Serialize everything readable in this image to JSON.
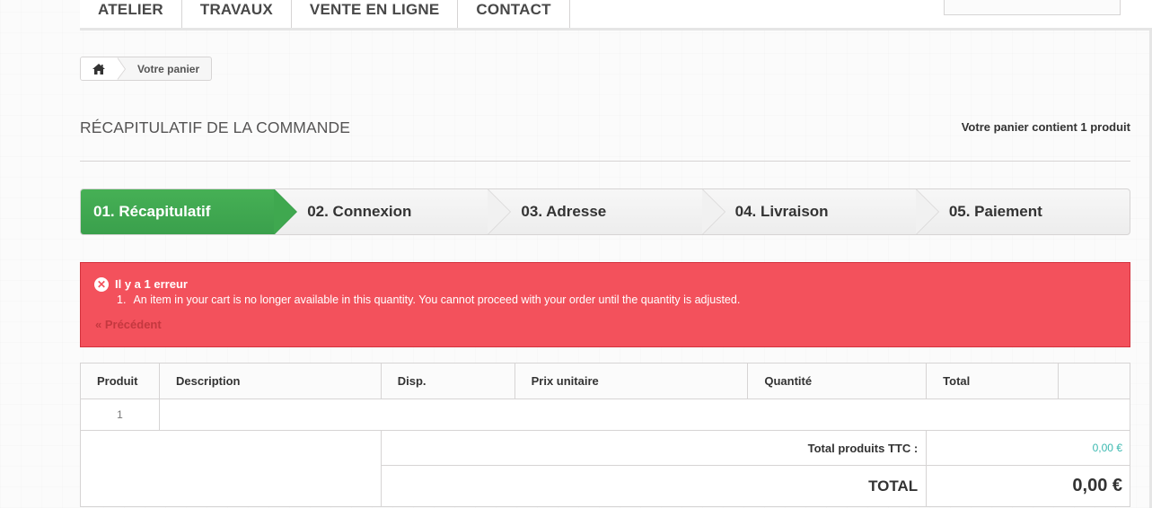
{
  "nav": {
    "items": [
      "ATELIER",
      "TRAVAUX",
      "VENTE EN LIGNE",
      "CONTACT"
    ],
    "search_placeholder": ""
  },
  "breadcrumb": {
    "home_icon": "home-icon",
    "current": "Votre panier"
  },
  "heading": {
    "title": "RÉCAPITULATIF DE LA COMMANDE",
    "cart_summary": "Votre panier contient 1 produit"
  },
  "steps": [
    {
      "label": "01. Récapitulatif",
      "active": true
    },
    {
      "label": "02. Connexion",
      "active": false
    },
    {
      "label": "03. Adresse",
      "active": false
    },
    {
      "label": "04. Livraison",
      "active": false
    },
    {
      "label": "05. Paiement",
      "active": false
    }
  ],
  "alert": {
    "icon": "error-circle-icon",
    "title": "Il y a 1 erreur",
    "errors": [
      {
        "num": "1.",
        "text": "An item in your cart is no longer available in this quantity. You cannot proceed with your order until the quantity is adjusted."
      }
    ],
    "back_link": "« Précédent",
    "colors": {
      "background": "#f3515c",
      "border": "#d4323d"
    }
  },
  "table": {
    "headers": [
      "Produit",
      "Description",
      "Disp.",
      "Prix unitaire",
      "Quantité",
      "Total",
      ""
    ],
    "rows": [
      {
        "index": "1"
      }
    ],
    "subtotal_label": "Total produits TTC :",
    "subtotal_value": "0,00 €",
    "total_label": "TOTAL",
    "total_value": "0,00 €"
  },
  "colors": {
    "step_active": "#46b055",
    "accent_teal": "#3bb9b0"
  }
}
